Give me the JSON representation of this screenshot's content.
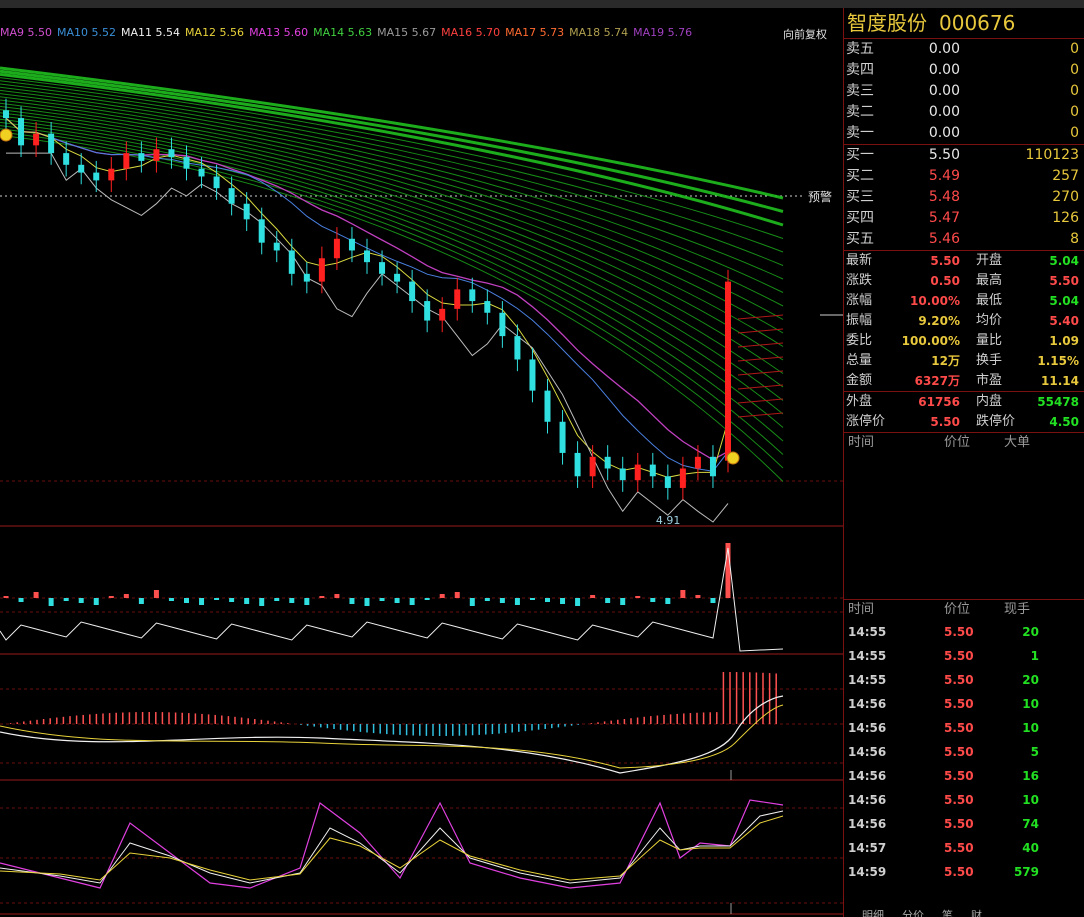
{
  "stock": {
    "name": "智度股份",
    "code": "000676"
  },
  "ma_legend": [
    {
      "label": "MA9",
      "value": "5.50",
      "color": "#d050d0"
    },
    {
      "label": "MA10",
      "value": "5.52",
      "color": "#3a8fd8"
    },
    {
      "label": "MA11",
      "value": "5.54",
      "color": "#f0f0f0"
    },
    {
      "label": "MA12",
      "value": "5.56",
      "color": "#e8d23a"
    },
    {
      "label": "MA13",
      "value": "5.60",
      "color": "#e040e0"
    },
    {
      "label": "MA14",
      "value": "5.63",
      "color": "#40d040"
    },
    {
      "label": "MA15",
      "value": "5.67",
      "color": "#9a9a9a"
    },
    {
      "label": "MA16",
      "value": "5.70",
      "color": "#ff4040"
    },
    {
      "label": "MA17",
      "value": "5.73",
      "color": "#ff6a30"
    },
    {
      "label": "MA18",
      "value": "5.74",
      "color": "#b0a050"
    },
    {
      "label": "MA19",
      "value": "5.76",
      "color": "#a040c0"
    }
  ],
  "adjust_label": "向前复权",
  "warning_label": "预警",
  "low_label": "4.91",
  "quote": {
    "sell": [
      {
        "label": "卖五",
        "price": "0.00",
        "vol": "0"
      },
      {
        "label": "卖四",
        "price": "0.00",
        "vol": "0"
      },
      {
        "label": "卖三",
        "price": "0.00",
        "vol": "0"
      },
      {
        "label": "卖二",
        "price": "0.00",
        "vol": "0"
      },
      {
        "label": "卖一",
        "price": "0.00",
        "vol": "0"
      }
    ],
    "buy": [
      {
        "label": "买一",
        "price": "5.50",
        "vol": "110123",
        "color": "white"
      },
      {
        "label": "买二",
        "price": "5.49",
        "vol": "257",
        "color": "red"
      },
      {
        "label": "买三",
        "price": "5.48",
        "vol": "270",
        "color": "red"
      },
      {
        "label": "买四",
        "price": "5.47",
        "vol": "126",
        "color": "red"
      },
      {
        "label": "买五",
        "price": "5.46",
        "vol": "8",
        "color": "red"
      }
    ]
  },
  "stats": [
    {
      "l1": "最新",
      "v1": "5.50",
      "c1": "red",
      "l2": "开盘",
      "v2": "5.04",
      "c2": "green"
    },
    {
      "l1": "涨跌",
      "v1": "0.50",
      "c1": "red",
      "l2": "最高",
      "v2": "5.50",
      "c2": "red"
    },
    {
      "l1": "涨幅",
      "v1": "10.00%",
      "c1": "red",
      "l2": "最低",
      "v2": "5.04",
      "c2": "green"
    },
    {
      "l1": "振幅",
      "v1": "9.20%",
      "c1": "yellow",
      "l2": "均价",
      "v2": "5.40",
      "c2": "red"
    },
    {
      "l1": "委比",
      "v1": "100.00%",
      "c1": "yellow",
      "l2": "量比",
      "v2": "1.09",
      "c2": "yellow"
    },
    {
      "l1": "总量",
      "v1": "12万",
      "c1": "yellow",
      "l2": "换手",
      "v2": "1.15%",
      "c2": "yellow"
    },
    {
      "l1": "金额",
      "v1": "6327万",
      "c1": "red",
      "l2": "市盈",
      "v2": "11.14",
      "c2": "yellow"
    }
  ],
  "stats2": [
    {
      "l1": "外盘",
      "v1": "61756",
      "c1": "red",
      "l2": "内盘",
      "v2": "55478",
      "c2": "green"
    },
    {
      "l1": "涨停价",
      "v1": "5.50",
      "c1": "red",
      "l2": "跌停价",
      "v2": "4.50",
      "c2": "green"
    }
  ],
  "big_orders_header": {
    "time": "时间",
    "price": "价位",
    "big": "大单"
  },
  "ticks_header": {
    "time": "时间",
    "price": "价位",
    "vol": "现手"
  },
  "ticks": [
    {
      "time": "14:55",
      "price": "5.50",
      "vol": "20"
    },
    {
      "time": "14:55",
      "price": "5.50",
      "vol": "1"
    },
    {
      "time": "14:55",
      "price": "5.50",
      "vol": "20"
    },
    {
      "time": "14:56",
      "price": "5.50",
      "vol": "10"
    },
    {
      "time": "14:56",
      "price": "5.50",
      "vol": "10"
    },
    {
      "time": "14:56",
      "price": "5.50",
      "vol": "5"
    },
    {
      "time": "14:56",
      "price": "5.50",
      "vol": "16"
    },
    {
      "time": "14:56",
      "price": "5.50",
      "vol": "10"
    },
    {
      "time": "14:56",
      "price": "5.50",
      "vol": "74"
    },
    {
      "time": "14:57",
      "price": "5.50",
      "vol": "40"
    },
    {
      "time": "14:59",
      "price": "5.50",
      "vol": "579"
    }
  ],
  "bottom_tabs": [
    "明细",
    "分价",
    "笔",
    "财"
  ],
  "chart_data": {
    "type": "candlestick",
    "note_series": "daily K-line, approx. values read from chart",
    "closes": [
      5.92,
      5.85,
      5.88,
      5.83,
      5.8,
      5.78,
      5.76,
      5.79,
      5.83,
      5.81,
      5.84,
      5.82,
      5.79,
      5.77,
      5.74,
      5.7,
      5.66,
      5.6,
      5.58,
      5.52,
      5.5,
      5.56,
      5.61,
      5.58,
      5.55,
      5.52,
      5.5,
      5.45,
      5.4,
      5.43,
      5.48,
      5.45,
      5.42,
      5.36,
      5.3,
      5.22,
      5.14,
      5.06,
      5.0,
      5.05,
      5.02,
      4.99,
      5.03,
      5.0,
      4.97,
      5.02,
      5.05,
      5.0,
      5.5
    ],
    "low": 4.91,
    "last": 5.5
  }
}
